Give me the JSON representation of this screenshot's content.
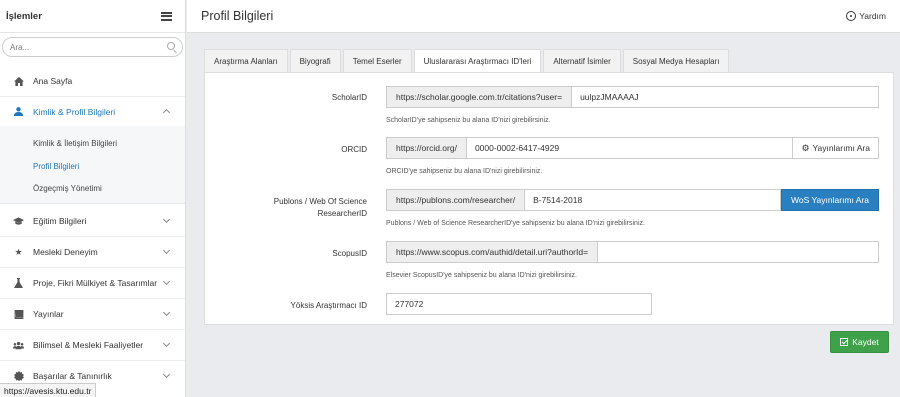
{
  "sidebar": {
    "title": "İşlemler",
    "search_placeholder": "Ara...",
    "items": [
      {
        "label": "Ana Sayfa",
        "icon": "home-icon"
      },
      {
        "label": "Kimlik & Profil Bilgileri",
        "icon": "user-icon"
      },
      {
        "label": "Eğitim Bilgileri",
        "icon": "graduation-cap-icon"
      },
      {
        "label": "Mesleki Deneyim",
        "icon": "star-icon"
      },
      {
        "label": "Proje, Fikri Mülkiyet & Tasarımlar",
        "icon": "flask-icon"
      },
      {
        "label": "Yayınlar",
        "icon": "book-icon"
      },
      {
        "label": "Bilimsel & Mesleki Faaliyetler",
        "icon": "users-icon"
      },
      {
        "label": "Başarılar & Tanınırlık",
        "icon": "badge-icon"
      }
    ],
    "sub_items": [
      {
        "label": "Kimlik & İletişim Bilgileri"
      },
      {
        "label": "Profil Bilgileri"
      },
      {
        "label": "Özgeçmiş Yönetimi"
      }
    ]
  },
  "status_bar": "https://avesis.ktu.edu.tr",
  "header": {
    "title": "Profil Bilgileri",
    "help_label": "Yardım"
  },
  "tabs": [
    {
      "label": "Araştırma Alanları"
    },
    {
      "label": "Biyografi"
    },
    {
      "label": "Temel Eserler"
    },
    {
      "label": "Uluslararası Araştırmacı ID'leri"
    },
    {
      "label": "Alternatif İsimler"
    },
    {
      "label": "Sosyal Medya Hesapları"
    }
  ],
  "form": {
    "scholar": {
      "label": "ScholarID",
      "prefix": "https://scholar.google.com.tr/citations?user=",
      "value": "uulpzJMAAAAJ",
      "help": "ScholarID'ye sahipseniz bu alana ID'nizi girebilirsiniz."
    },
    "orcid": {
      "label": "ORCID",
      "prefix": "https://orcid.org/",
      "value": "0000-0002-6417-4929",
      "button": "Yayınlarımı Ara",
      "help": "ORCID'ye sahipseniz bu alana ID'nizi girebilirsiniz."
    },
    "publons": {
      "label_line1": "Publons / Web Of Science",
      "label_line2": "ResearcherID",
      "prefix": "https://publons.com/researcher/",
      "value": "B-7514-2018",
      "button": "WoS Yayınlarımı Ara",
      "help": "Publons / Web of Science ResearcherID'ye sahipseniz bu alana ID'nizi girebilirsiniz."
    },
    "scopus": {
      "label": "ScopusID",
      "prefix": "https://www.scopus.com/authid/detail.uri?authorId=",
      "value": "",
      "help": "Elsevier ScopusID'ye sahipseniz bu alana ID'nizi girebilirsiniz."
    },
    "yoksis": {
      "label": "Yöksis Araştırmacı ID",
      "value": "277072"
    }
  },
  "save_label": "Kaydet",
  "colors": {
    "accent": "#1f77c0",
    "primary_button": "#2a7fc0",
    "save_button": "#3fa14a"
  }
}
